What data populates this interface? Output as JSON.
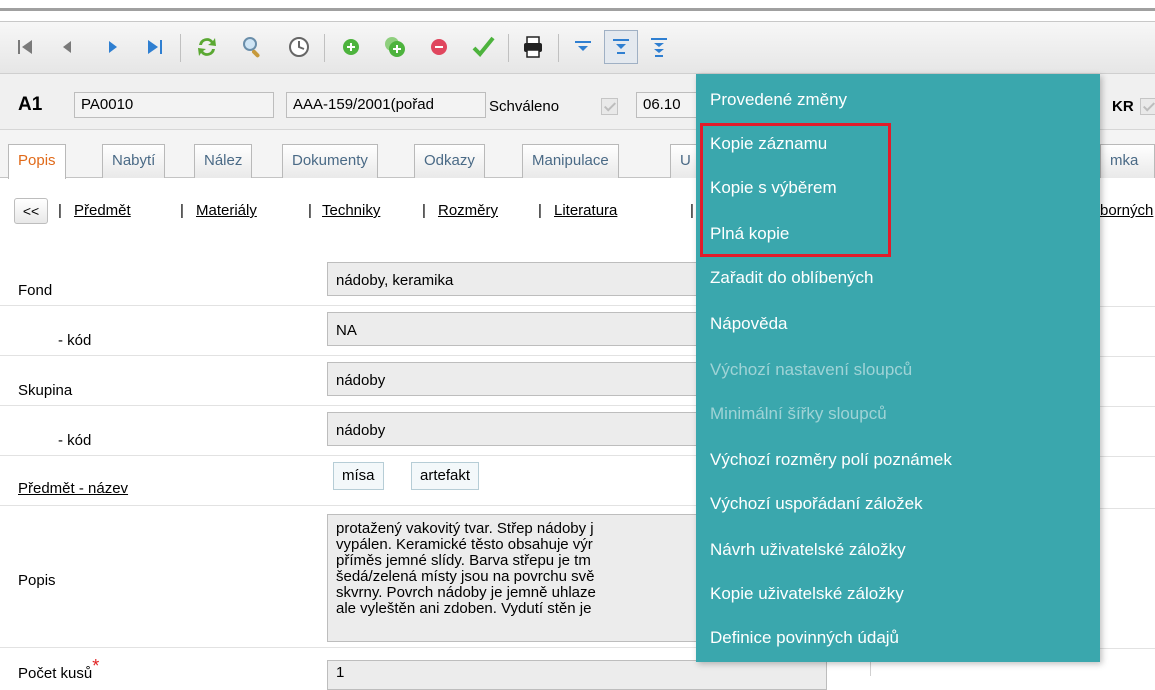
{
  "record": {
    "label": "A1",
    "code": "PA0010",
    "number": "AAA-159/2001(pořad",
    "status_label": "Schváleno",
    "date": "06.10",
    "kr_label": "KR"
  },
  "tabs": [
    "Popis",
    "Nabytí",
    "Nález",
    "Dokumenty",
    "Odkazy",
    "Manipulace",
    "U",
    "mka"
  ],
  "sublinks": {
    "back": "<<",
    "items": [
      "Předmět",
      "Materiály",
      "Techniky",
      "Rozměry",
      "Literatura"
    ],
    "truncated": "borných"
  },
  "form": {
    "fond_label": "Fond",
    "fond_value": "nádoby, keramika",
    "fond_kod_label": "- kód",
    "fond_kod_value": "NA",
    "skupina_label": "Skupina",
    "skupina_value": "nádoby",
    "skupina_kod_label": "- kód",
    "skupina_kod_value": "nádoby",
    "predmet_label": "Předmět - název",
    "predmet_values": [
      "mísa",
      "artefakt"
    ],
    "popis_label": "Popis",
    "popis_lines": [
      "protažený vakovitý tvar. Střep nádoby j",
      "vypálen. Keramické těsto obsahuje výr",
      "příměs jemné slídy. Barva střepu je tm",
      "šedá/zelená místy jsou na povrchu svě",
      "skvrny. Povrch nádoby je jemně uhlaze",
      "ale vyleštěn ani zdoben. Vydutí stěn je"
    ],
    "pocet_label": "Počet kusů",
    "pocet_value": "1"
  },
  "menu": {
    "items": [
      {
        "label": "Provedené změny",
        "enabled": true
      },
      {
        "label": "Kopie záznamu",
        "enabled": true
      },
      {
        "label": "Kopie s výběrem",
        "enabled": true
      },
      {
        "label": "Plná kopie",
        "enabled": true
      },
      {
        "label": "Zařadit do oblíbených",
        "enabled": true
      },
      {
        "label": "Nápověda",
        "enabled": true
      },
      {
        "label": "Výchozí nastavení sloupců",
        "enabled": false
      },
      {
        "label": "Minimální šířky sloupců",
        "enabled": false
      },
      {
        "label": "Výchozí rozměry polí poznámek",
        "enabled": true
      },
      {
        "label": "Výchozí uspořádaní záložek",
        "enabled": true
      },
      {
        "label": "Návrh uživatelské záložky",
        "enabled": true
      },
      {
        "label": "Kopie uživatelské záložky",
        "enabled": true
      },
      {
        "label": "Definice povinných údajů",
        "enabled": true
      }
    ]
  },
  "colors": {
    "menu_bg": "#3aa7ad",
    "highlight": "#e21b2a",
    "active_tab": "#e06a1a",
    "tab_text": "#4a6a86"
  }
}
